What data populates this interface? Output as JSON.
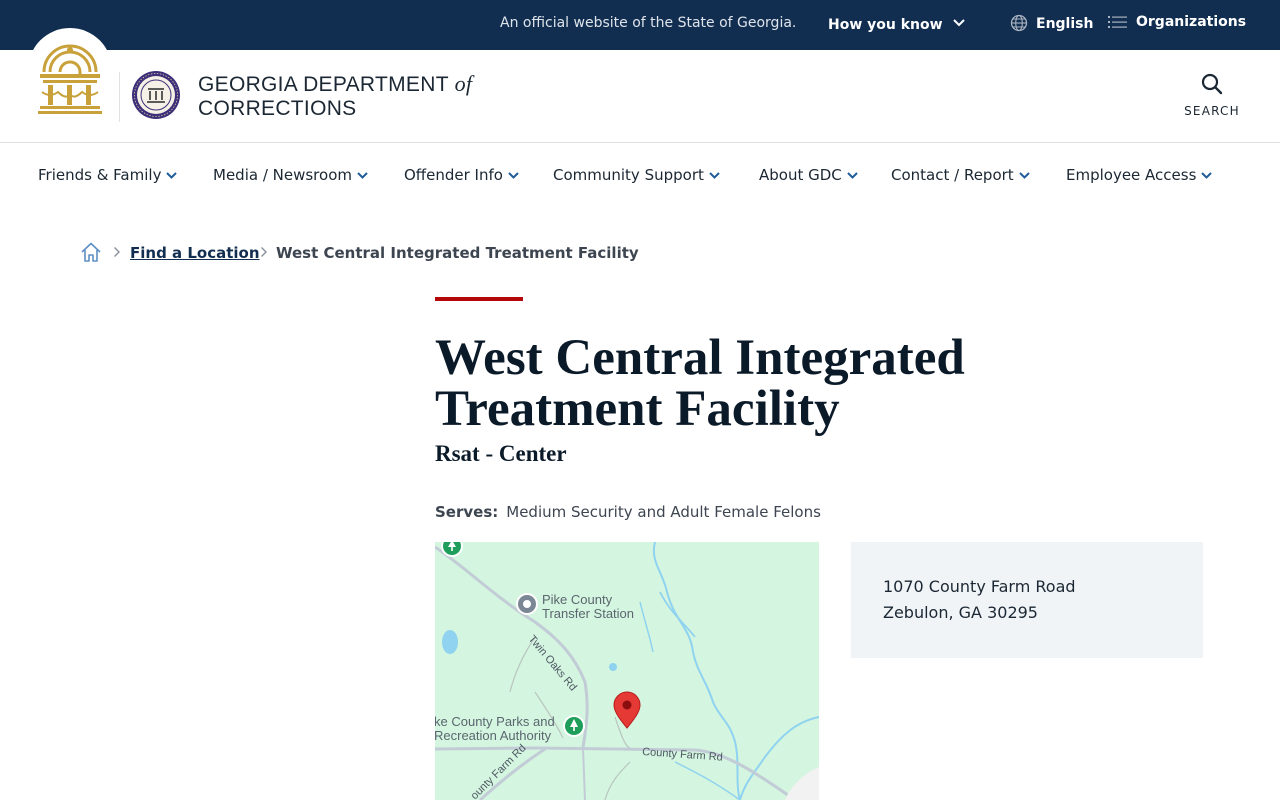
{
  "banner": {
    "official_text": "An official website of the State of Georgia.",
    "how_you_know": "How you know",
    "language": "English",
    "organizations": "Organizations"
  },
  "header": {
    "title_line1": "GEORGIA DEPARTMENT",
    "title_of": "of",
    "title_line2": "CORRECTIONS",
    "search_label": "SEARCH"
  },
  "nav": {
    "items": [
      {
        "label": "Friends & Family"
      },
      {
        "label": "Media / Newsroom"
      },
      {
        "label": "Offender Info"
      },
      {
        "label": "Community Support"
      },
      {
        "label": "About GDC"
      },
      {
        "label": "Contact / Report"
      },
      {
        "label": "Employee Access"
      }
    ]
  },
  "breadcrumb": {
    "link": "Find a Location",
    "current": "West Central Integrated Treatment Facility"
  },
  "facility": {
    "title": "West Central Integrated Treatment Facility",
    "subtitle": "Rsat - Center",
    "serves_label": "Serves:",
    "serves_value": "Medium Security and Adult Female Felons"
  },
  "map": {
    "labels": {
      "transfer_line1": "Pike County",
      "transfer_line2": "Transfer Station",
      "twin_oaks": "Twin Oaks Rd",
      "parks_line1": "ke County Parks and",
      "parks_line2": "Recreation Authority",
      "county_farm": "County Farm Rd",
      "county_farm_2": "ounty Farm Rd"
    }
  },
  "address": {
    "street": "1070 County Farm Road",
    "city_state_zip": "Zebulon, GA 30295"
  },
  "colors": {
    "banner_bg": "#112e51",
    "accent_red": "#b50909",
    "map_green": "#d4f5df",
    "address_bg": "#f1f4f7",
    "pin_red": "#e53935"
  }
}
